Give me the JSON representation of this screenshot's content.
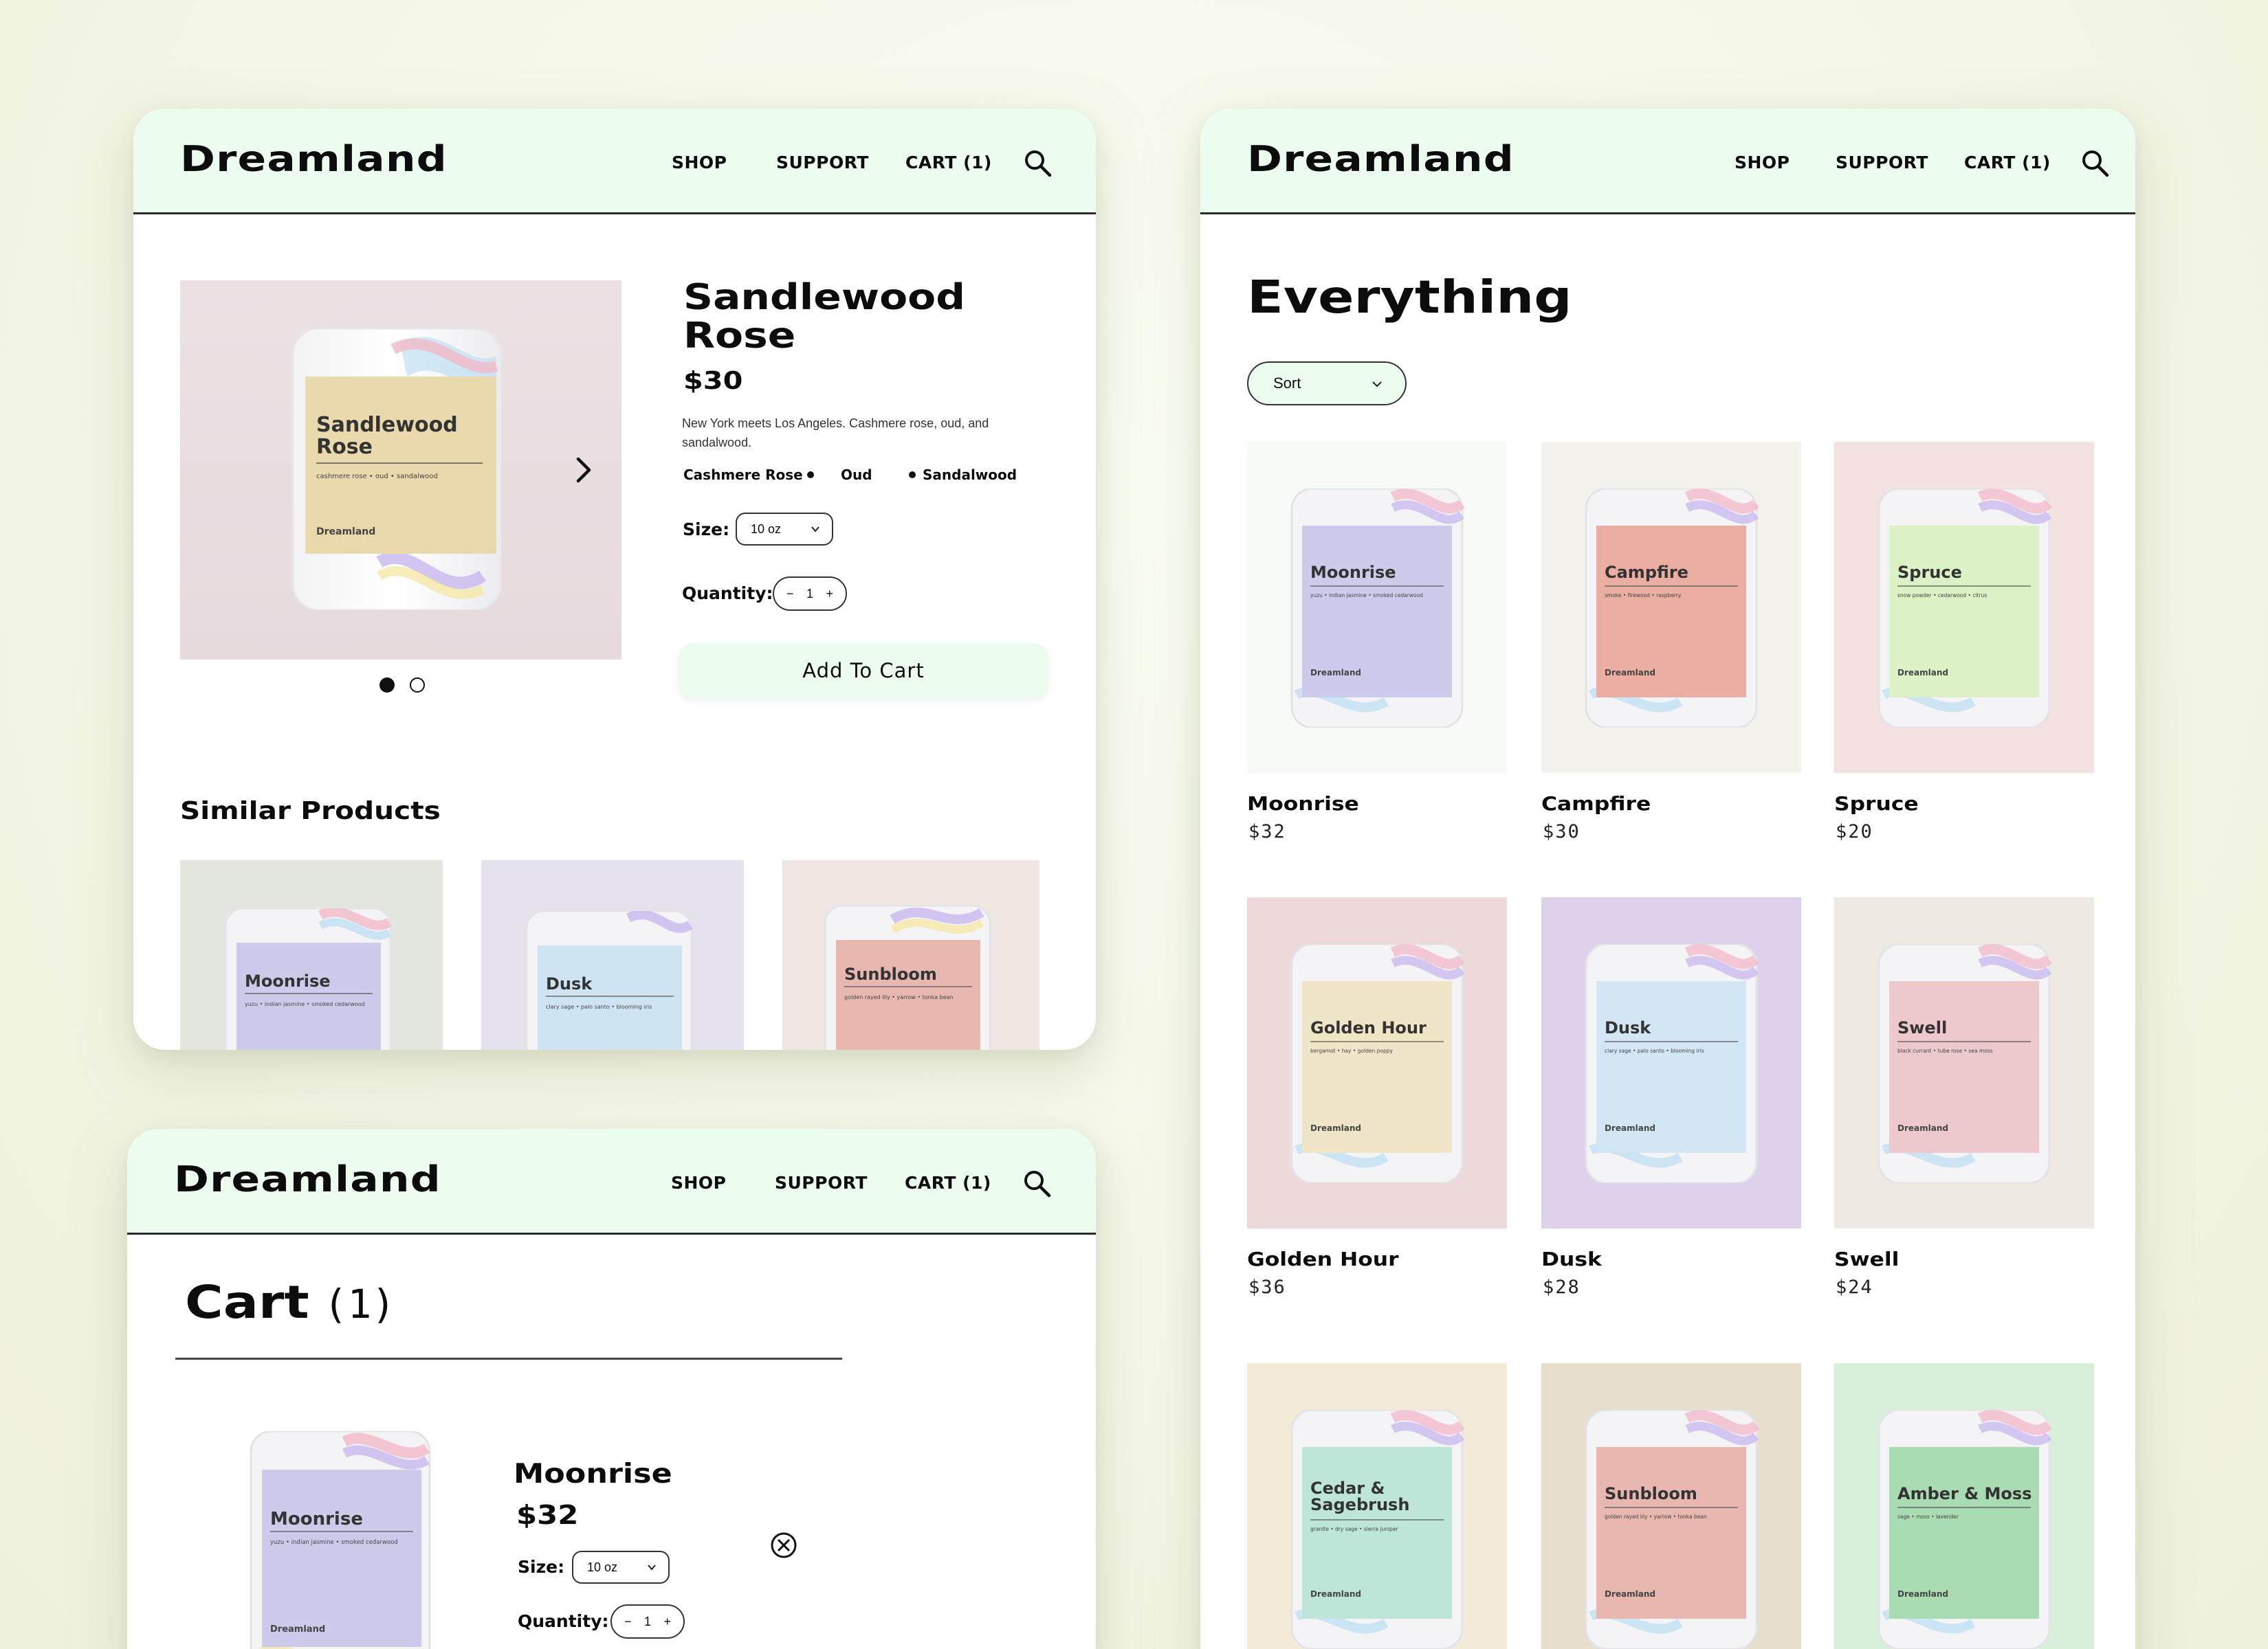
{
  "brand": "Dreamland",
  "nav": {
    "shop": "SHOP",
    "support": "SUPPORT",
    "cart": "CART (1)"
  },
  "colors": {
    "nav_bg": "#ecfdf0",
    "button_bg": "#ecfdf0",
    "page_bg": "#f6f8e8"
  },
  "product_page": {
    "title_line1": "Sandlewood",
    "title_line2": "Rose",
    "price": "$30",
    "description_line1": "New York meets Los Angeles. Cashmere rose, oud, and",
    "description_line2": "sandalwood.",
    "notes": [
      "Cashmere Rose",
      "Oud",
      "Sandalwood"
    ],
    "size_label": "Size:",
    "size_value": "10 oz",
    "quantity_label": "Quantity:",
    "quantity": "1",
    "add_to_cart": "Add To Cart",
    "image_label_line1": "Sandlewood",
    "image_label_line2": "Rose",
    "image_notes": "cashmere rose  •  oud  •  sandalwood",
    "image_brand": "Dreamland",
    "carousel_dots": 2,
    "carousel_active": 0,
    "similar_heading": "Similar Products",
    "similar": [
      {
        "name": "Moonrise",
        "notes": "yuzu  •  indian jasmine  •  smoked cedarwood"
      },
      {
        "name": "Dusk",
        "notes": "clary sage  •  palo santo  •  blooming iris"
      },
      {
        "name": "Sunbloom",
        "notes": "golden rayed lily  •  yarrow  •  tonka bean"
      }
    ]
  },
  "cart_page": {
    "title": "Cart",
    "count": "(1)",
    "item_name": "Moonrise",
    "item_price": "$32",
    "size_label": "Size:",
    "size_value": "10 oz",
    "quantity_label": "Quantity:",
    "quantity": "1",
    "image_label": "Moonrise",
    "image_notes": "yuzu  •  indian jasmine  •  smoked cedarwood",
    "image_brand": "Dreamland"
  },
  "shop_page": {
    "title": "Everything",
    "sort_label": "Sort",
    "products": [
      {
        "name": "Moonrise",
        "price": "$32",
        "notes": "yuzu  •  indian jasmine  •  smoked cedarwood"
      },
      {
        "name": "Campfire",
        "price": "$30",
        "notes": "smoke  •  firewood  •  raspberry"
      },
      {
        "name": "Spruce",
        "price": "$20",
        "notes": "snow powder  •  cedarwood  •  citrus"
      },
      {
        "name": "Golden Hour",
        "price": "$36",
        "notes": "bergamot  •  hay  •  golden poppy"
      },
      {
        "name": "Dusk",
        "price": "$28",
        "notes": "clary sage  •  palo santo  •  blooming iris"
      },
      {
        "name": "Swell",
        "price": "$24",
        "notes": "black currant  •  tube rose  •  sea moss"
      },
      {
        "name": "Cedar & Sagebrush",
        "price": "",
        "notes": "granite  •  dry sage  •  sierra juniper"
      },
      {
        "name": "Sunbloom",
        "price": "",
        "notes": "golden rayed lily  •  yarrow  •  tonka bean"
      },
      {
        "name": "Amber & Moss",
        "price": "",
        "notes": "sage  •  moss  •  lavender"
      }
    ],
    "label_brand": "Dreamland"
  }
}
